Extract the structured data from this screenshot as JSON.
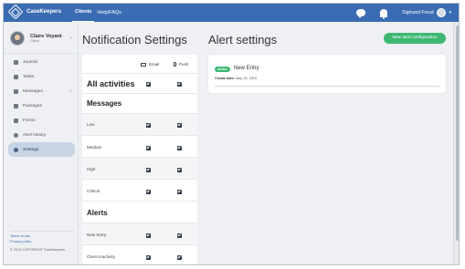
{
  "app": {
    "brand": "CaseKeepers"
  },
  "nav": {
    "items": [
      {
        "label": "Clients",
        "active": true
      },
      {
        "label": "Help/FAQs",
        "active": false
      }
    ]
  },
  "user": {
    "name": "Sigmund Freud"
  },
  "profile": {
    "name": "Claire Voyant",
    "role": "Client"
  },
  "sidebar": {
    "items": [
      {
        "label": "Journal",
        "icon": "journal-icon"
      },
      {
        "label": "Tasks",
        "icon": "tasks-icon"
      },
      {
        "label": "Messages",
        "icon": "messages-icon"
      },
      {
        "label": "Packages",
        "icon": "packages-icon"
      },
      {
        "label": "Forms",
        "icon": "forms-icon"
      },
      {
        "label": "Alert history",
        "icon": "alert-history-icon"
      },
      {
        "label": "Settings",
        "icon": "settings-icon",
        "active": true
      }
    ],
    "footer": {
      "terms": "Terms of use",
      "privacy": "Privacy policy",
      "copyright": "© 2019 COPYRIGHT CaseKeepers"
    }
  },
  "notification_settings": {
    "title": "Notification Settings",
    "columns": {
      "email": "Email",
      "push": "Push"
    },
    "all_activities": "All activities",
    "messages_heading": "Messages",
    "message_rows": [
      "Low",
      "Medium",
      "High",
      "Critical"
    ],
    "alerts_heading": "Alerts",
    "alert_rows": [
      "New Entry",
      "Client Inactivity"
    ]
  },
  "alert_settings": {
    "title": "Alert settings",
    "new_button": "New alert configuration",
    "card": {
      "badge": "Active",
      "name": "New Entry",
      "date_label": "Create date:",
      "date_value": "May 16, 2019"
    }
  },
  "colors": {
    "topbar": "#3a6cb3",
    "accent_green": "#3db873",
    "active_nav": "#c6d4e4"
  }
}
